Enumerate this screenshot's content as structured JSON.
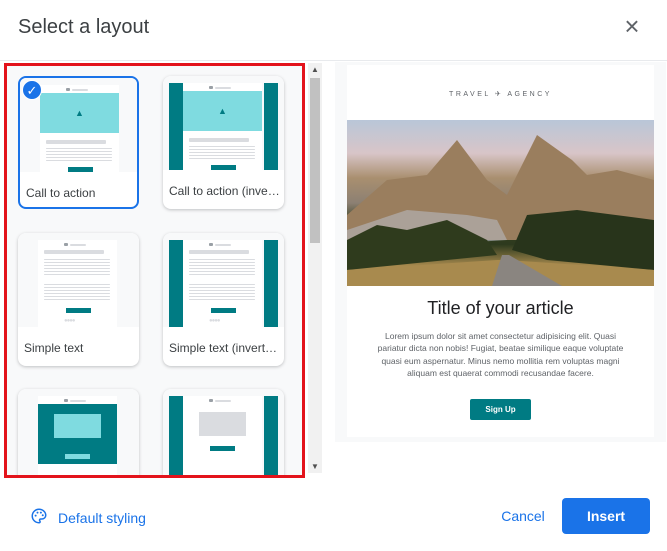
{
  "dialog": {
    "title": "Select a layout",
    "close_icon": "close-icon"
  },
  "layouts": [
    {
      "label": "Call to action",
      "variant": "cta",
      "inverted": false,
      "selected": true
    },
    {
      "label": "Call to action (inverted)",
      "variant": "cta",
      "inverted": true,
      "selected": false
    },
    {
      "label": "Simple text",
      "variant": "text",
      "inverted": false,
      "selected": false
    },
    {
      "label": "Simple text (inverted)",
      "variant": "text",
      "inverted": true,
      "selected": false
    },
    {
      "label": "",
      "variant": "teal",
      "inverted": false,
      "selected": false
    },
    {
      "label": "",
      "variant": "grey",
      "inverted": true,
      "selected": false
    }
  ],
  "preview": {
    "logo_text": "TRAVEL ✈ AGENCY",
    "article_title": "Title of your article",
    "body": "Lorem ipsum dolor sit amet consectetur adipisicing elit. Quasi pariatur dicta non nobis! Fugiat, beatae similique eaque voluptate quasi eum aspernatur. Minus nemo mollitia rem voluptas magni aliquam est quaerat commodi recusandae facere.",
    "button": "Sign Up"
  },
  "footer": {
    "default_styling": "Default styling",
    "cancel": "Cancel",
    "insert": "Insert"
  },
  "colors": {
    "accent": "#1a73e8",
    "teal": "#007b83",
    "light_teal": "#7fdbe0",
    "highlight": "#e3131b"
  }
}
